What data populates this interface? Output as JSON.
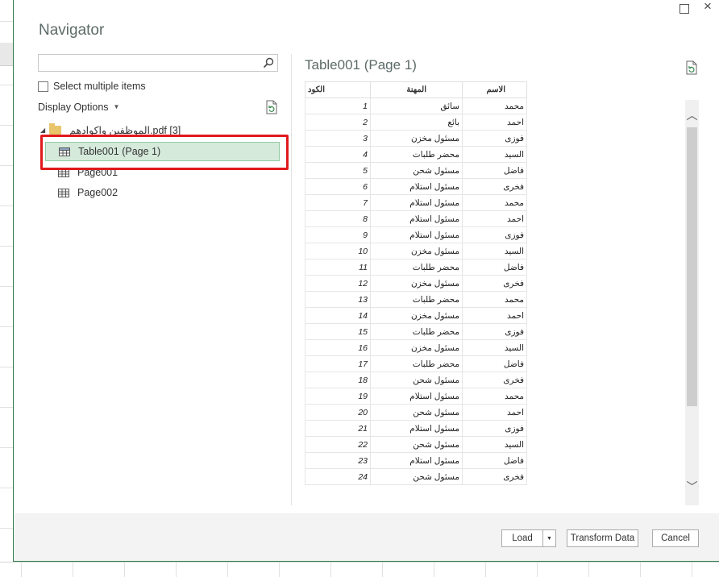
{
  "window": {
    "title": "Navigator",
    "maximize_icon": "maximize-icon",
    "close_glyph": "×"
  },
  "left_pane": {
    "search": {
      "value": "",
      "placeholder": ""
    },
    "select_multiple_label": "Select multiple items",
    "display_options_label": "Display Options",
    "tree": {
      "folder_label": "الموظفين واكوادهم.pdf [3]",
      "items": [
        {
          "label": "Table001 (Page 1)",
          "selected": true
        },
        {
          "label": "Page001",
          "selected": false
        },
        {
          "label": "Page002",
          "selected": false
        }
      ]
    }
  },
  "preview": {
    "title": "Table001 (Page 1)",
    "columns": [
      "الكود",
      "المهنة",
      "الاسم"
    ],
    "rows": [
      [
        "1",
        "سائق",
        "محمد"
      ],
      [
        "2",
        "بائع",
        "احمد"
      ],
      [
        "3",
        "مسئول مخزن",
        "فوزى"
      ],
      [
        "4",
        "محضر طلبات",
        "السيد"
      ],
      [
        "5",
        "مسئول شحن",
        "فاضل"
      ],
      [
        "6",
        "مسئول استلام",
        "فخرى"
      ],
      [
        "7",
        "مسئول استلام",
        "محمد"
      ],
      [
        "8",
        "مسئول استلام",
        "احمد"
      ],
      [
        "9",
        "مسئول استلام",
        "فوزى"
      ],
      [
        "10",
        "مسئول مخزن",
        "السيد"
      ],
      [
        "11",
        "محضر طلبات",
        "فاضل"
      ],
      [
        "12",
        "مسئول مخزن",
        "فخرى"
      ],
      [
        "13",
        "محضر طلبات",
        "محمد"
      ],
      [
        "14",
        "مسئول مخزن",
        "احمد"
      ],
      [
        "15",
        "محضر طلبات",
        "فوزى"
      ],
      [
        "16",
        "مسئول مخزن",
        "السيد"
      ],
      [
        "17",
        "محضر طلبات",
        "فاضل"
      ],
      [
        "18",
        "مسئول شحن",
        "فخرى"
      ],
      [
        "19",
        "مسئول استلام",
        "محمد"
      ],
      [
        "20",
        "مسئول شحن",
        "احمد"
      ],
      [
        "21",
        "مسئول استلام",
        "فوزى"
      ],
      [
        "22",
        "مسئول شحن",
        "السيد"
      ],
      [
        "23",
        "مسئول استلام",
        "فاضل"
      ],
      [
        "24",
        "مسئول شحن",
        "فخرى"
      ]
    ]
  },
  "footer": {
    "load_label": "Load",
    "transform_label": "Transform Data",
    "cancel_label": "Cancel"
  },
  "colors": {
    "selection_fill": "#d5eadb",
    "highlight_box": "#e0191c",
    "dialog_border": "#2e7d4b"
  }
}
